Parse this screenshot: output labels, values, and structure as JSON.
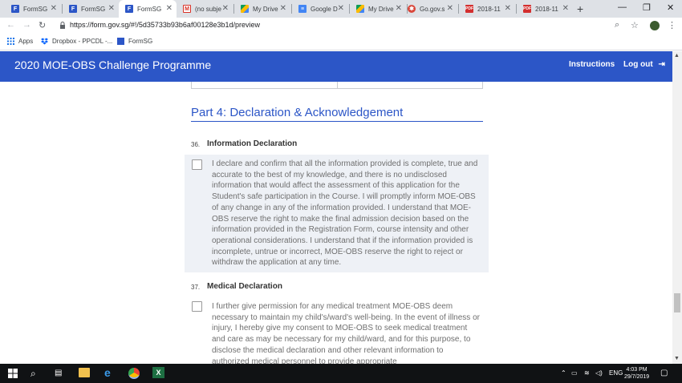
{
  "browser": {
    "tabs": [
      {
        "label": "FormSG",
        "icon": "formsg-icon",
        "color": "#2c56c7",
        "active": false
      },
      {
        "label": "FormSG",
        "icon": "formsg-icon",
        "color": "#2c56c7",
        "active": false
      },
      {
        "label": "FormSG",
        "icon": "formsg-icon",
        "color": "#2c56c7",
        "active": true
      },
      {
        "label": "(no subje",
        "icon": "gmail-icon",
        "color": "#d93025",
        "active": false
      },
      {
        "label": "My Drive",
        "icon": "drive-icon",
        "color": "#1a73e8",
        "active": false
      },
      {
        "label": "Google D",
        "icon": "docs-icon",
        "color": "#4285f4",
        "active": false
      },
      {
        "label": "My Drive",
        "icon": "drive-icon",
        "color": "#1a73e8",
        "active": false
      },
      {
        "label": "Go.gov.s",
        "icon": "gogov-icon",
        "color": "#d9463a",
        "active": false
      },
      {
        "label": "2018-11",
        "icon": "pdf-icon",
        "color": "#d32f2f",
        "active": false
      },
      {
        "label": "2018-11",
        "icon": "pdf-icon",
        "color": "#d32f2f",
        "active": false
      }
    ],
    "url": "https://form.gov.sg/#!/5d35733b93b6af00128e3b1d/preview",
    "bookmarks": [
      {
        "label": "Apps"
      },
      {
        "label": "Dropbox - PPCDL -..."
      },
      {
        "label": "FormSG"
      }
    ]
  },
  "app": {
    "title": "2020 MOE-OBS Challenge Programme",
    "instructions": "Instructions",
    "logout": "Log out",
    "accent": "#2c56c7"
  },
  "section": {
    "title": "Part 4: Declaration & Acknowledgement"
  },
  "questions": [
    {
      "number": "36.",
      "title": "Information Declaration",
      "text": "I declare and confirm that all the information provided is complete, true and accurate to the best of my knowledge, and there is no undisclosed information that would affect the assessment of this application for the Student's safe participation in the Course. I will promptly inform MOE-OBS of any change in any of the information provided. I understand that MOE-OBS reserve the right to make the final admission decision based on the information provided in the Registration Form, course intensity and other operational considerations. I understand that if the information provided is incomplete, untrue or incorrect, MOE-OBS reserve the right to reject or withdraw the application at any time."
    },
    {
      "number": "37.",
      "title": "Medical Declaration",
      "text": "I further give permission for any medical treatment MOE-OBS deem necessary to maintain my child's/ward's well-being. In the event of illness or injury, I hereby give my consent to MOE-OBS to seek medical treatment and care as may be necessary for my child/ward, and for this purpose, to disclose the medical declaration and other relevant information to authorized medical personnel to provide appropriate"
    }
  ],
  "taskbar": {
    "language": "ENG",
    "time": "4:03 PM",
    "date": "29/7/2019"
  }
}
